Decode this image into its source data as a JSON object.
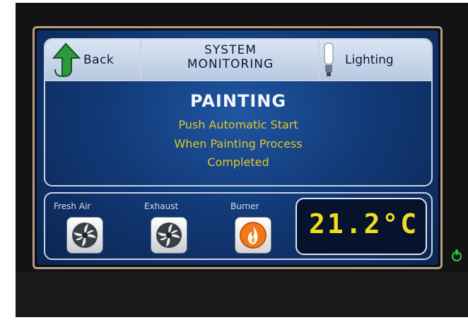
{
  "header": {
    "back_label": "Back",
    "title_line1": "SYSTEM",
    "title_line2": "MONITORING",
    "lighting_label": "Lighting"
  },
  "main": {
    "mode_title": "PAINTING",
    "message_lines": [
      "Push Automatic Start",
      "When Painting Process",
      "Completed"
    ]
  },
  "devices": [
    {
      "label": "Fresh Air",
      "icon": "fan-icon"
    },
    {
      "label": "Exhaust",
      "icon": "fan-icon"
    },
    {
      "label": "Burner",
      "icon": "flame-icon"
    }
  ],
  "temperature": {
    "value": "21.2",
    "unit": "°C"
  },
  "colors": {
    "accent_text": "#e0c72a",
    "screen_blue": "#1f56a3",
    "temp_digits": "#f0de1c"
  }
}
